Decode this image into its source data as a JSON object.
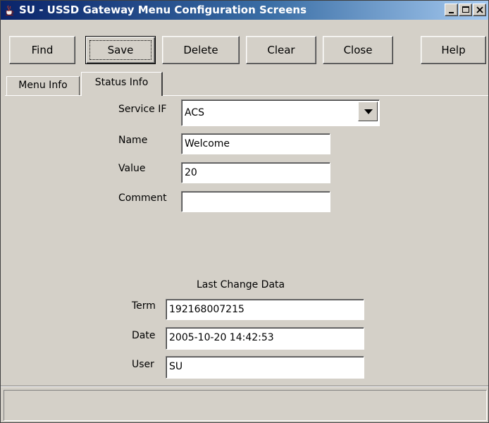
{
  "window": {
    "title": "SU - USSD Gateway Menu Configuration Screens",
    "icon": "java-cup-icon"
  },
  "toolbar": {
    "find_label": "Find",
    "save_label": "Save",
    "delete_label": "Delete",
    "clear_label": "Clear",
    "close_label": "Close",
    "help_label": "Help"
  },
  "tabs": [
    {
      "label": "Menu Info",
      "active": false
    },
    {
      "label": "Status Info",
      "active": true
    }
  ],
  "form": {
    "service_if_label": "Service IF",
    "service_if_value": "ACS",
    "name_label": "Name",
    "name_value": "Welcome",
    "value_label": "Value",
    "value_value": "20",
    "comment_label": "Comment",
    "comment_value": ""
  },
  "last_change": {
    "heading": "Last Change Data",
    "term_label": "Term",
    "term_value": "192168007215",
    "date_label": "Date",
    "date_value": "2005-10-20 14:42:53",
    "user_label": "User",
    "user_value": "SU"
  },
  "statusbar": {
    "text": ""
  }
}
